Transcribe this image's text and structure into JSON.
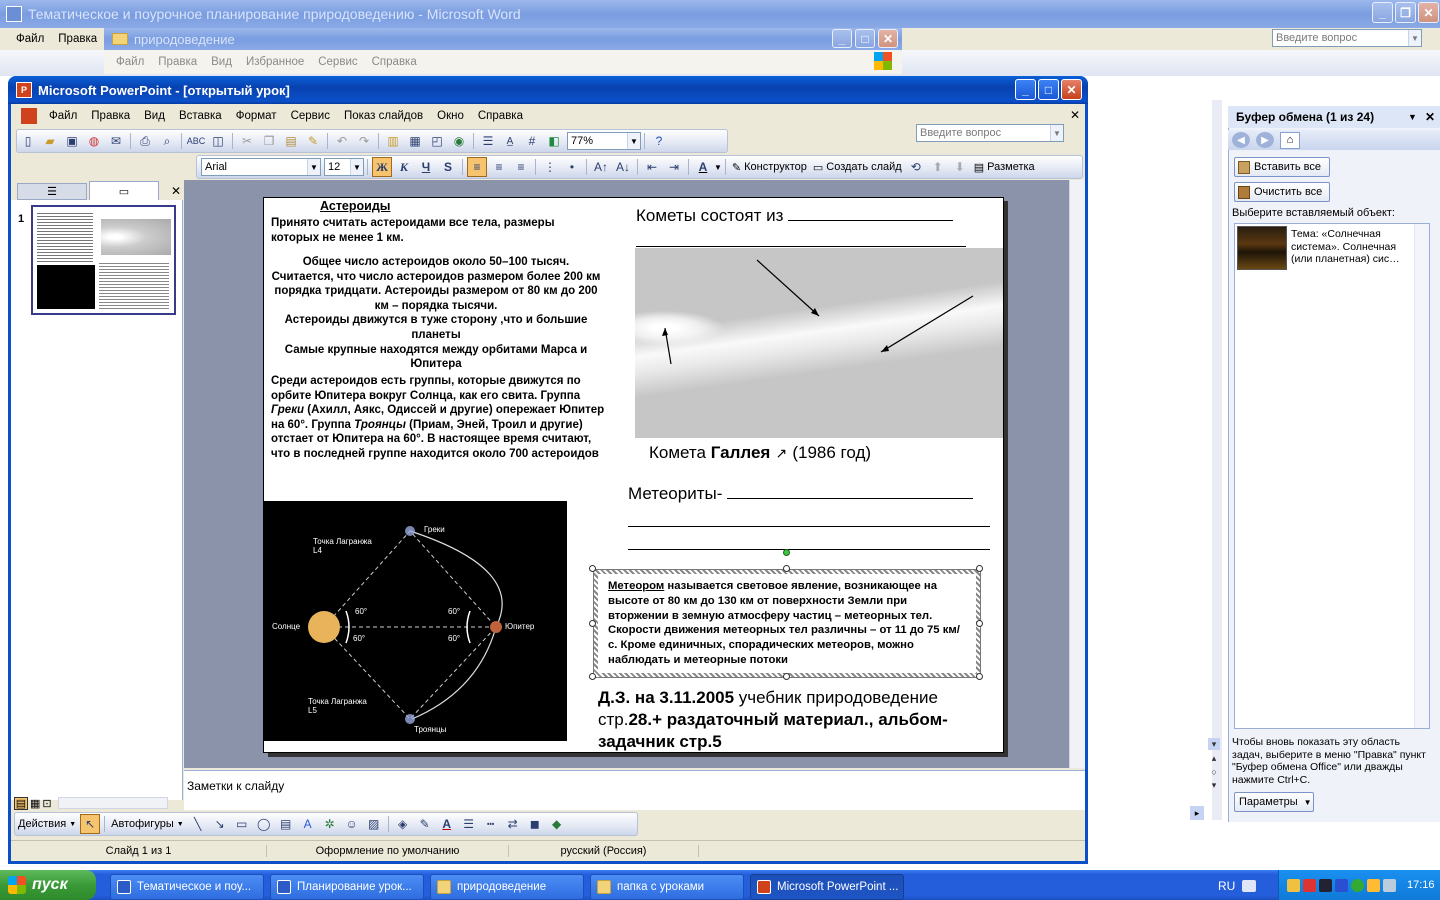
{
  "word": {
    "title": "Тематическое и поурочное планирование природоведению - Microsoft Word",
    "menu": [
      "Файл",
      "Правка"
    ],
    "help_placeholder": "Введите вопрос"
  },
  "explorer": {
    "title": "природоведение",
    "menu": [
      "Файл",
      "Правка",
      "Вид",
      "Избранное",
      "Сервис",
      "Справка"
    ]
  },
  "ppt": {
    "title": "Microsoft PowerPoint - [открытый урок]",
    "menu": [
      "Файл",
      "Правка",
      "Вид",
      "Вставка",
      "Формат",
      "Сервис",
      "Показ слайдов",
      "Окно",
      "Справка"
    ],
    "help_placeholder": "Введите вопрос",
    "zoom": "77%",
    "font_name": "Arial",
    "font_size": "12",
    "designer_label": "Конструктор",
    "new_slide_label": "Создать слайд",
    "layout_label": "Разметка",
    "slide_number": "1",
    "notes_placeholder": "Заметки к слайду",
    "drawing": {
      "actions": "Действия",
      "autoshapes": "Автофигуры"
    },
    "status": {
      "slide": "Слайд 1 из 1",
      "design": "Оформление по умолчанию",
      "language": "русский (Россия)"
    }
  },
  "slide": {
    "asteroids_title": "Астероиды",
    "asteroids_intro": "Принято считать астероидами все тела, размеры которых не менее 1 км.",
    "asteroids_center": [
      "Общее число астероидов около 50–100 тысяч.",
      "Считается, что число астероидов размером более 200 км порядка тридцати. Астероиды размером от 80 км до 200 км – порядка тысячи.",
      "Астероиды движутся в туже сторону ,что и большие планеты",
      "Самые крупные находятся между орбитами Марса и Юпитера"
    ],
    "asteroids_groups": {
      "part1": "Среди астероидов есть группы, которые движутся по орбите Юпитера вокруг Солнца, как его свита. Группа ",
      "greeks": "Греки",
      "part2": " (Ахилл, Аякс, Одиссей и другие) опережает Юпитер на 60°. Группа ",
      "trojans": "Троянцы",
      "part3": " (Приам, Эней, Троил и другие) отстает от Юпитера на 60°. В настоящее время считают, что в последней группе находится около 700 астероидов"
    },
    "comets_label": "Кометы состоят из ",
    "comet_caption_prefix": "Комета ",
    "comet_caption_name": "Галлея",
    "comet_caption_year": "(1986 год)",
    "meteorites_label": "Метеориты- ",
    "meteor_term": "Метеором",
    "meteor_text": "  называется световое явление, возникающее на высоте от 80 км до 130 км от поверхности Земли при вторжении в земную атмосферу частиц – метеорных тел. Скорости движения метеорных тел различны – от 11 до 75 км/с. Кроме единичных, спорадических метеоров, можно наблюдать и метеорные потоки",
    "homework_line1_bold": "Д.З. на 3.11.2005",
    "homework_line1_normal": " учебник природоведение",
    "homework_line2_normal": "стр.",
    "homework_line2_bold": "28.+ раздаточный материал., альбом-",
    "homework_line3": "задачник стр.5",
    "diagram": {
      "greeks": "Греки",
      "trojans": "Троянцы",
      "sun": "Солнце",
      "jupiter": "Юпитер",
      "l4": "Точка Лагранжа",
      "l4_sub": "L4",
      "l5": "Точка Лагранжа",
      "l5_sub": "L5",
      "angle": "60°"
    }
  },
  "clipboard": {
    "title": "Буфер обмена (1 из 24)",
    "paste_all": "Вставить все",
    "clear_all": "Очистить все",
    "select_prompt": "Выберите вставляемый объект:",
    "item_text": "Тема: «Солнечная система». Солнечная (или планетная) сис…",
    "footer_text": "Чтобы вновь показать эту область задач, выберите в меню \"Правка\" пункт \"Буфер обмена Office\" или дважды нажмите Ctrl+C.",
    "options_label": "Параметры"
  },
  "taskbar": {
    "start": "пуск",
    "buttons": [
      "Тематическое и поу...",
      "Планирование  урок...",
      "природоведение",
      "папка с уроками",
      "Microsoft PowerPoint ..."
    ],
    "lang": "RU",
    "clock": "17:16"
  }
}
